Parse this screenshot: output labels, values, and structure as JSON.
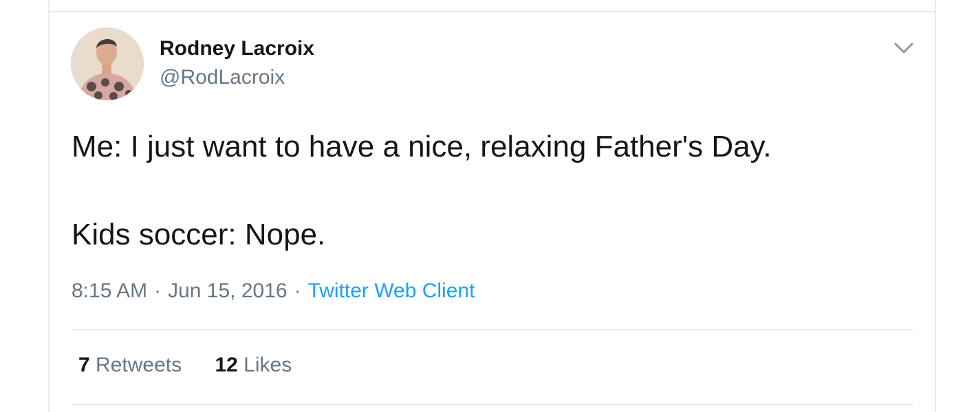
{
  "author": {
    "name": "Rodney Lacroix",
    "handle": "@RodLacroix"
  },
  "tweet": {
    "lines": [
      "Me: I just want to have a nice, relaxing Father's Day.",
      "Kids soccer: Nope."
    ],
    "time": "8:15 AM",
    "date": "Jun 15, 2016",
    "separator": "·",
    "source": "Twitter Web Client"
  },
  "stats": {
    "retweets_count": "7",
    "retweets_label": "Retweets",
    "likes_count": "12",
    "likes_label": "Likes"
  },
  "icons": {
    "menu": "chevron-down-icon"
  },
  "colors": {
    "text": "#14171a",
    "muted": "#657786",
    "link": "#1da1f2",
    "border": "#e6ecf0"
  }
}
